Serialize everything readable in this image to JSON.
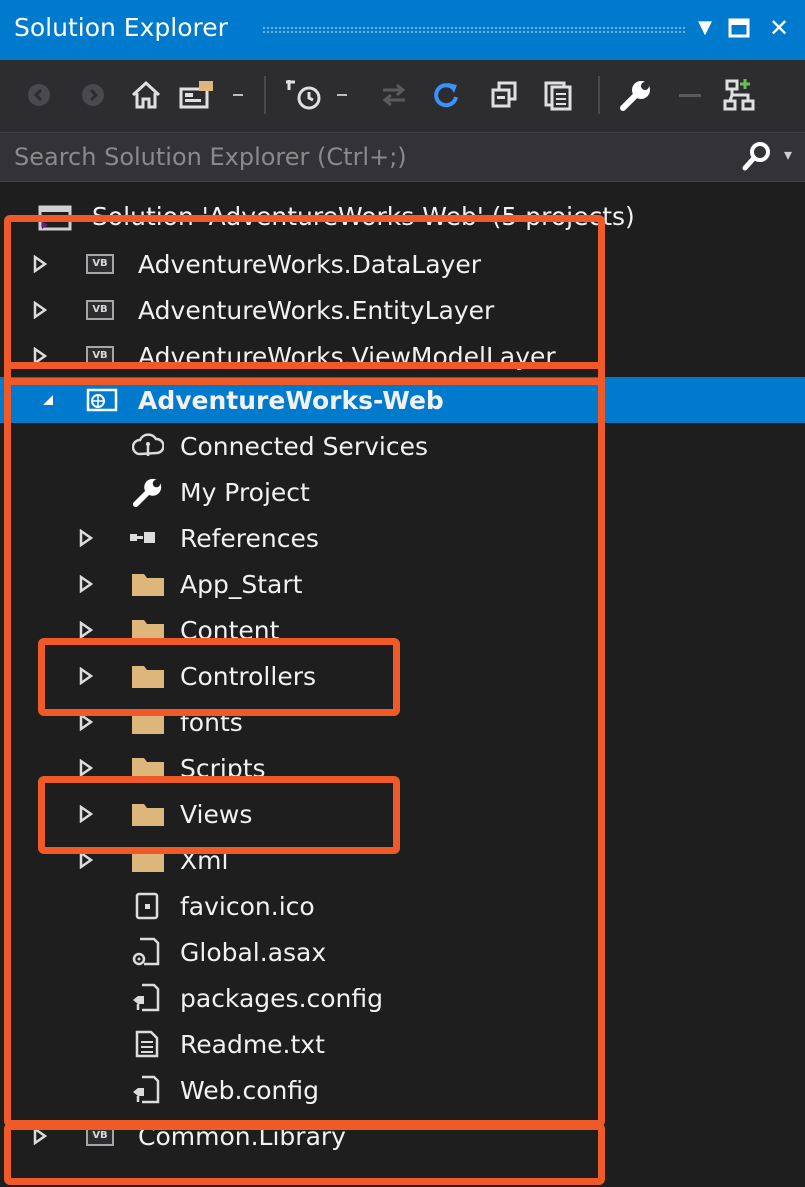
{
  "window": {
    "title": "Solution Explorer",
    "controls": {
      "menu_glyph": "▼",
      "maximize_glyph": "□",
      "close_glyph": "✕"
    }
  },
  "toolbar": {
    "icons": [
      "back-icon",
      "forward-icon",
      "home-icon",
      "switch-views-icon",
      "dropdown-icon",
      "pending-changes-filter-icon",
      "dropdown-icon",
      "sync-with-document-icon",
      "refresh-icon",
      "collapse-all-icon",
      "show-all-files-icon",
      "properties-icon",
      "preview-icon",
      "class-diagram-icon"
    ]
  },
  "search": {
    "placeholder": "Search Solution Explorer (Ctrl+;)",
    "value": ""
  },
  "tree": {
    "solution": {
      "label": "Solution 'AdventureWorks-Web' (5 projects)"
    },
    "projects_top": [
      {
        "label": "AdventureWorks.DataLayer"
      },
      {
        "label": "AdventureWorks.EntityLayer"
      },
      {
        "label": "AdventureWorks.ViewModelLayer"
      }
    ],
    "web_project": {
      "label": "AdventureWorks-Web",
      "children": [
        {
          "label": "Connected Services",
          "icon": "connected-services-icon"
        },
        {
          "label": "My Project",
          "icon": "wrench-icon"
        },
        {
          "label": "References",
          "icon": "references-icon"
        },
        {
          "label": "App_Start",
          "icon": "folder-icon"
        },
        {
          "label": "Content",
          "icon": "folder-icon"
        },
        {
          "label": "Controllers",
          "icon": "folder-icon"
        },
        {
          "label": "fonts",
          "icon": "folder-icon"
        },
        {
          "label": "Scripts",
          "icon": "folder-icon"
        },
        {
          "label": "Views",
          "icon": "folder-icon"
        },
        {
          "label": "Xml",
          "icon": "folder-icon"
        },
        {
          "label": "favicon.ico",
          "icon": "image-file-icon"
        },
        {
          "label": "Global.asax",
          "icon": "global-asax-icon"
        },
        {
          "label": "packages.config",
          "icon": "config-file-icon"
        },
        {
          "label": "Readme.txt",
          "icon": "text-file-icon"
        },
        {
          "label": "Web.config",
          "icon": "config-file-icon"
        }
      ]
    },
    "projects_bottom": [
      {
        "label": "Common.Library"
      }
    ],
    "vb_badge": "VB"
  },
  "colors": {
    "titlebar": "#007acc",
    "background": "#1e1e1e",
    "selection": "#007acc",
    "highlight_box": "#f05a28",
    "folder": "#dcb67a",
    "text": "#f1f1f1"
  }
}
